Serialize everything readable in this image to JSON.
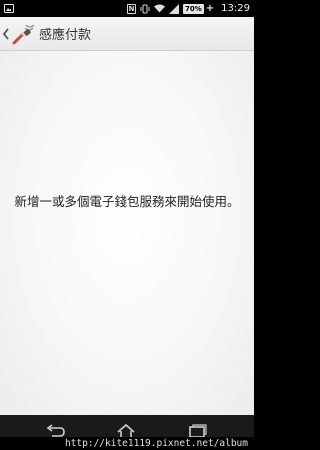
{
  "status_bar": {
    "battery_label": "70%",
    "battery_plus": "+",
    "time": "13:29",
    "icons": [
      "image-notification-icon",
      "nfc-icon",
      "vibrate-icon",
      "wifi-icon",
      "signal-icon",
      "battery-icon"
    ]
  },
  "app_bar": {
    "title": "感應付款",
    "back_icon": "chevron-left-icon",
    "app_icon": "tap-to-pay-icon"
  },
  "content": {
    "message": "新增一或多個電子錢包服務來開始使用。"
  },
  "nav_bar": {
    "buttons": [
      "back-icon",
      "home-icon",
      "recent-apps-icon"
    ]
  },
  "watermark": {
    "text": "http://kite1119.pixnet.net/album"
  },
  "colors": {
    "status_bar": "#000000",
    "app_bar": "#efefef",
    "content_bg": "#f7f7f7",
    "nav_bar": "#1a1a1a"
  }
}
